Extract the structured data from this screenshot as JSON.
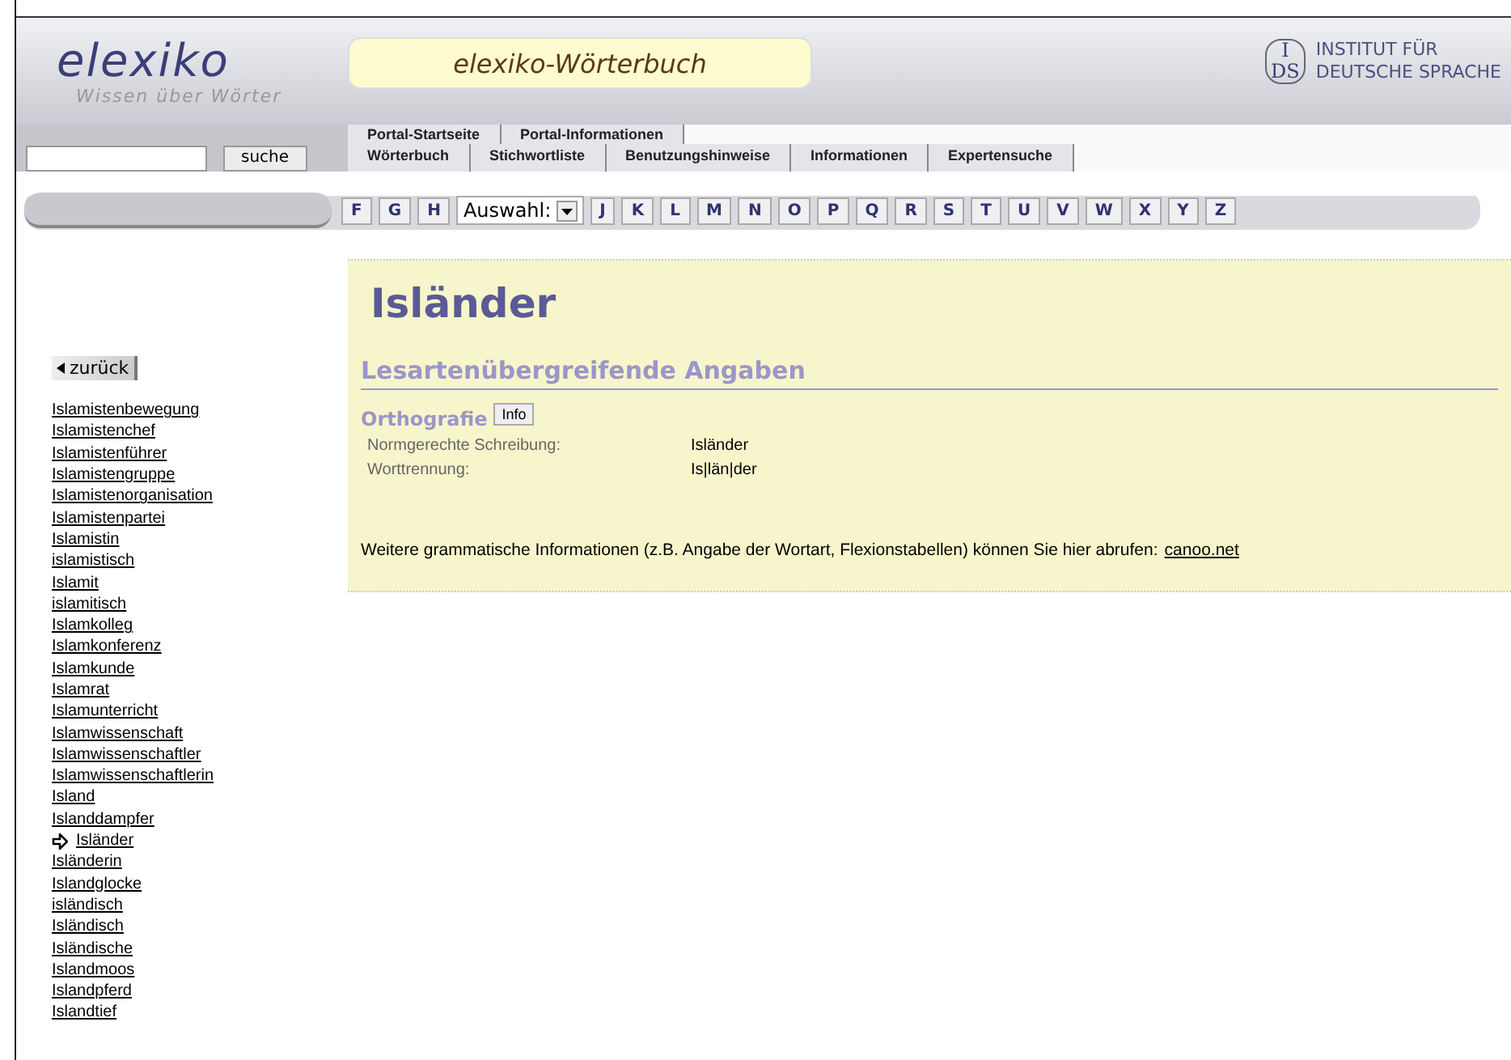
{
  "logo": {
    "name": "elexiko",
    "tagline": "Wissen über Wörter"
  },
  "banner_title": "elexiko-Wörterbuch",
  "institute": {
    "emblem_top": "I",
    "emblem_bottom": "DS",
    "line1": "INSTITUT FÜR",
    "line2": "DEUTSCHE SPRACHE"
  },
  "portal_tabs": [
    "Portal-Startseite",
    "Portal-Informationen"
  ],
  "search": {
    "button": "suche"
  },
  "main_tabs": [
    "Wörterbuch",
    "Stichwortliste",
    "Benutzungshinweise",
    "Informationen",
    "Expertensuche"
  ],
  "alphabet": {
    "before": [
      "F",
      "G",
      "H"
    ],
    "select": "Auswahl:",
    "after": [
      "J",
      "K",
      "L",
      "M",
      "N",
      "O",
      "P",
      "Q",
      "R",
      "S",
      "T",
      "U",
      "V",
      "W",
      "X",
      "Y",
      "Z"
    ]
  },
  "back_button": "zurück",
  "word_list": [
    {
      "word": "Islamistenbewegung",
      "selected": false
    },
    {
      "word": "Islamistenchef",
      "selected": false
    },
    {
      "word": "Islamistenführer",
      "selected": false
    },
    {
      "word": "Islamistengruppe",
      "selected": false
    },
    {
      "word": "Islamistenorganisation",
      "selected": false
    },
    {
      "word": "Islamistenpartei",
      "selected": false
    },
    {
      "word": "Islamistin",
      "selected": false
    },
    {
      "word": "islamistisch",
      "selected": false
    },
    {
      "word": "Islamit",
      "selected": false
    },
    {
      "word": "islamitisch",
      "selected": false
    },
    {
      "word": "Islamkolleg",
      "selected": false
    },
    {
      "word": "Islamkonferenz",
      "selected": false
    },
    {
      "word": "Islamkunde",
      "selected": false
    },
    {
      "word": "Islamrat",
      "selected": false
    },
    {
      "word": "Islamunterricht",
      "selected": false
    },
    {
      "word": "Islamwissenschaft",
      "selected": false
    },
    {
      "word": "Islamwissenschaftler",
      "selected": false
    },
    {
      "word": "Islamwissenschaftlerin",
      "selected": false
    },
    {
      "word": "Island",
      "selected": false
    },
    {
      "word": "Islanddampfer",
      "selected": false
    },
    {
      "word": "Isländer",
      "selected": true
    },
    {
      "word": "Isländerin",
      "selected": false
    },
    {
      "word": "Islandglocke",
      "selected": false
    },
    {
      "word": "isländisch",
      "selected": false
    },
    {
      "word": "Isländisch",
      "selected": false
    },
    {
      "word": "Isländische",
      "selected": false
    },
    {
      "word": "Islandmoos",
      "selected": false
    },
    {
      "word": "Islandpferd",
      "selected": false
    },
    {
      "word": "Islandtief",
      "selected": false
    }
  ],
  "entry": {
    "headword": "Isländer",
    "section": "Lesartenübergreifende Angaben",
    "subsection": "Orthografie",
    "info_button": "Info",
    "fields": [
      {
        "label": "Normgerechte Schreibung:",
        "value": "Isländer"
      },
      {
        "label": "Worttrennung:",
        "value": "Is|län|der"
      }
    ],
    "note": "Weitere grammatische Informationen (z.B. Angabe der Wortart, Flexionstabellen) können Sie hier abrufen:",
    "link": "canoo.net"
  }
}
